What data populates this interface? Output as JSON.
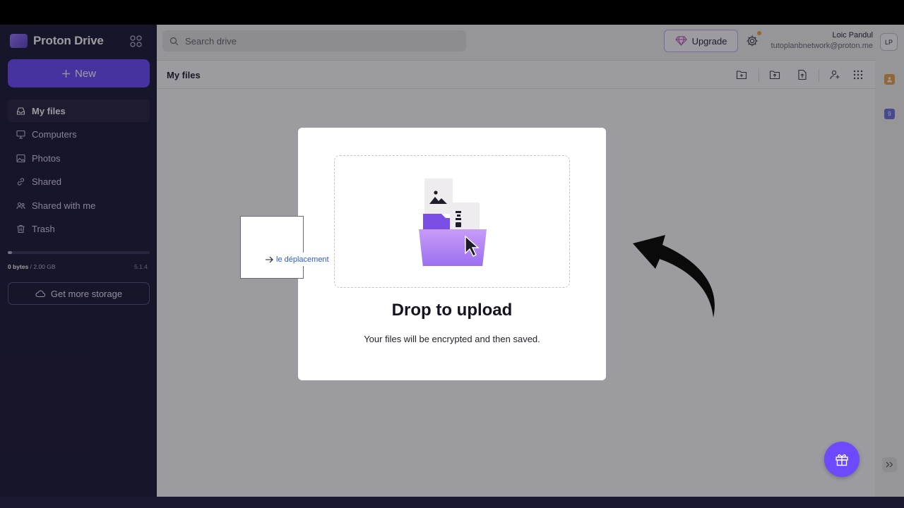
{
  "brand": {
    "name": "Proton Drive"
  },
  "sidebar": {
    "new_label": "New",
    "items": [
      {
        "label": "My files",
        "icon": "drive-icon",
        "active": true
      },
      {
        "label": "Computers",
        "icon": "monitor-icon"
      },
      {
        "label": "Photos",
        "icon": "image-icon"
      },
      {
        "label": "Shared",
        "icon": "link-icon"
      },
      {
        "label": "Shared with me",
        "icon": "users-icon"
      },
      {
        "label": "Trash",
        "icon": "trash-icon"
      }
    ],
    "storage": {
      "used": "0 bytes",
      "separator": " / ",
      "total": "2.00 GB",
      "fill_fraction": 0.03
    },
    "version": "5.1.4",
    "get_more_storage_label": "Get more storage"
  },
  "header": {
    "search_placeholder": "Search drive",
    "upgrade_label": "Upgrade",
    "user_name": "Loic Pandul",
    "user_email": "tutoplanbnetwork@proton.me",
    "avatar_initials": "LP"
  },
  "main": {
    "title": "My files"
  },
  "rail": {
    "calendar_day": "9"
  },
  "upload_dialog": {
    "title": "Drop to upload",
    "subtitle": "Your files will be encrypted and then saved."
  },
  "drag_tooltip": {
    "label": "le déplacement"
  },
  "colors": {
    "accent": "#6d4aff",
    "sidebar_bg": "#1b1832",
    "link_blue": "#2a5bd7"
  }
}
